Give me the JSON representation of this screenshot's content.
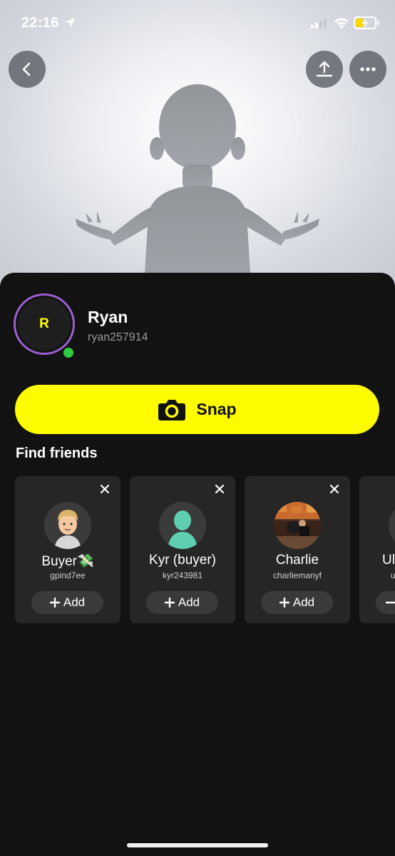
{
  "status_bar": {
    "time": "22:16"
  },
  "profile": {
    "initial": "R",
    "display_name": "Ryan",
    "username": "ryan257914"
  },
  "snap_button": {
    "label": "Snap"
  },
  "find_friends": {
    "title": "Find friends",
    "add_label": "Add",
    "cards": [
      {
        "name": "Buyer💸",
        "handle": "gpind7ee"
      },
      {
        "name": "Kyr (buyer)",
        "handle": "kyr243981"
      },
      {
        "name": "Charlie",
        "handle": "charliemanyf"
      },
      {
        "name": "Ul",
        "handle": "u"
      }
    ]
  },
  "colors": {
    "accent": "#fffc00",
    "ring": "#9b5fd0",
    "online": "#2ecc40",
    "background": "#121212"
  },
  "icons": [
    "location-arrow-icon",
    "signal-icon",
    "wifi-icon",
    "battery-charging-icon",
    "back-chevron-icon",
    "share-icon",
    "more-icon",
    "camera-icon",
    "close-icon",
    "plus-icon"
  ]
}
